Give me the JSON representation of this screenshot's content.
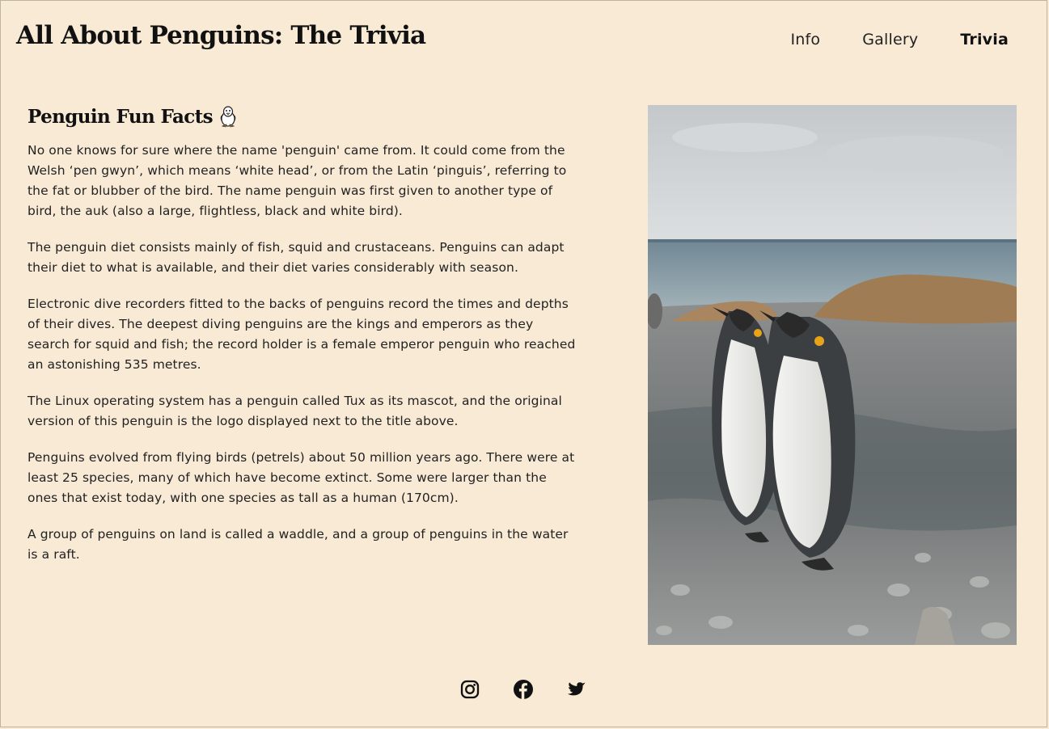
{
  "site": {
    "title": "All About Penguins: The Trivia"
  },
  "nav": {
    "items": [
      {
        "label": "Info",
        "active": false
      },
      {
        "label": "Gallery",
        "active": false
      },
      {
        "label": "Trivia",
        "active": true
      }
    ]
  },
  "main": {
    "heading": "Penguin Fun Facts",
    "heading_icon": "tux-penguin-icon",
    "paragraphs": [
      "No one knows for sure where the name 'penguin' came from. It could come from the Welsh ‘pen gwyn’, which means ‘white head’, or from the Latin ‘pinguis’, referring to the fat or blubber of the bird. The name penguin was first given to another type of bird, the auk (also a large, flightless, black and white bird).",
      "The penguin diet consists mainly of fish, squid and crustaceans. Penguins can adapt their diet to what is available, and their diet varies considerably with season.",
      "Electronic dive recorders fitted to the backs of penguins record the times and depths of their dives. The deepest diving penguins are the kings and emperors as they search for squid and fish; the record holder is a female emperor penguin who reached an astonishing 535 metres.",
      "The Linux operating system has a penguin called Tux as its mascot, and the original version of this penguin is the logo displayed next to the title above.",
      "Penguins evolved from flying birds (petrels) about 50 million years ago. There were at least 25 species, many of which have become extinct. Some were larger than the ones that exist today, with one species as tall as a human (170cm).",
      "A group of penguins on land is called a waddle, and a group of penguins in the water is a raft."
    ]
  },
  "photo": {
    "subject": "king-penguins-on-beach"
  },
  "footer": {
    "socials": [
      {
        "icon": "instagram-icon"
      },
      {
        "icon": "facebook-icon"
      },
      {
        "icon": "twitter-icon"
      }
    ]
  },
  "colors": {
    "background": "#f9ead6",
    "text": "#1a1a1a"
  }
}
